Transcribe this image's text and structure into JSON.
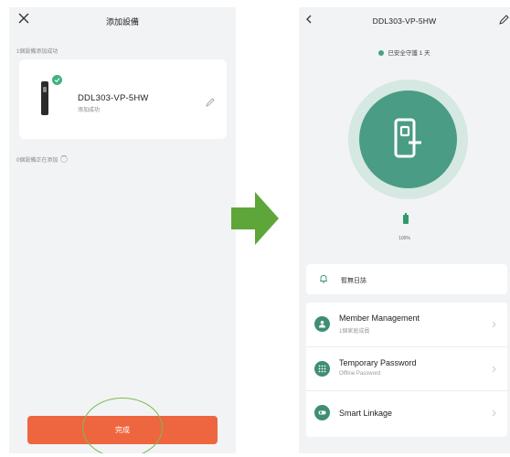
{
  "left_screen": {
    "title": "添加設備",
    "success_label": "1個設備添加成功",
    "device": {
      "name": "DDL303-VP-5HW",
      "status": "添加成功"
    },
    "pending_label": "0個設備正在添加",
    "done_label": "完成"
  },
  "right_screen": {
    "title": "DDL303-VP-5HW",
    "guard_text": "已安全守護 1 天",
    "battery_percent": "100%",
    "log_label": "暫無日誌",
    "menu": [
      {
        "title": "Member Management",
        "subtitle": "1個家庭成員"
      },
      {
        "title": "Temporary Password",
        "subtitle": "Offline Password"
      },
      {
        "title": "Smart Linkage",
        "subtitle": ""
      }
    ]
  },
  "colors": {
    "accent_orange": "#ee6640",
    "success_green": "#43b27f",
    "lock_teal": "#4a9c84",
    "arrow_green": "#5fa63a",
    "annotation_green": "#7dbb4e"
  }
}
